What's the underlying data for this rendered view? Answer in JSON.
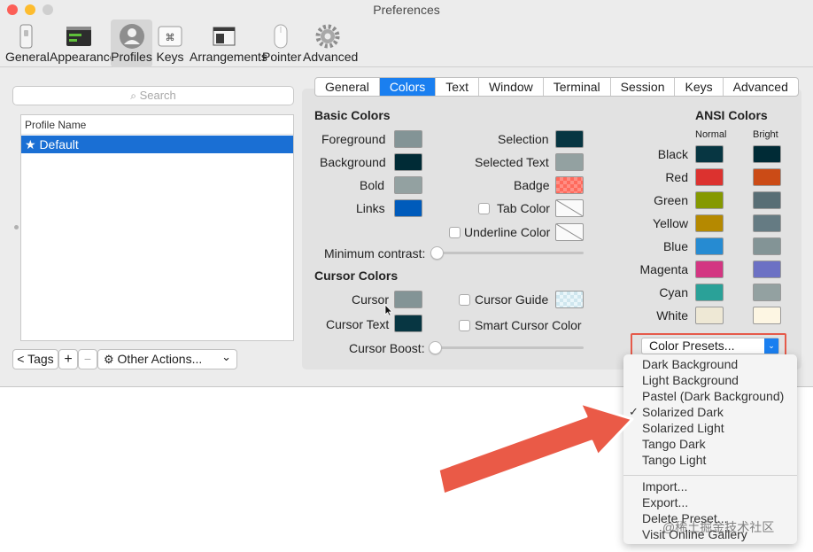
{
  "window": {
    "title": "Preferences"
  },
  "toolbar": {
    "items": [
      {
        "label": "General"
      },
      {
        "label": "Appearance"
      },
      {
        "label": "Profiles"
      },
      {
        "label": "Keys"
      },
      {
        "label": "Arrangements"
      },
      {
        "label": "Pointer"
      },
      {
        "label": "Advanced"
      }
    ],
    "keys_glyph": "⌘"
  },
  "sidebar": {
    "search_placeholder": "Search",
    "list_header": "Profile Name",
    "profiles": [
      {
        "label": "★ Default"
      }
    ],
    "tags_button": "< Tags",
    "add_button": "+",
    "remove_button": "−",
    "other_actions": "Other Actions...",
    "chevron": "⌄"
  },
  "tabs": [
    {
      "label": "General"
    },
    {
      "label": "Colors"
    },
    {
      "label": "Text"
    },
    {
      "label": "Window"
    },
    {
      "label": "Terminal"
    },
    {
      "label": "Session"
    },
    {
      "label": "Keys"
    },
    {
      "label": "Advanced"
    }
  ],
  "basic_colors": {
    "heading": "Basic Colors",
    "foreground": "Foreground",
    "background": "Background",
    "bold": "Bold",
    "links": "Links",
    "selection": "Selection",
    "selected_text": "Selected Text",
    "badge": "Badge",
    "tab_color": "Tab Color",
    "underline_color": "Underline Color",
    "minimum_contrast": "Minimum contrast:",
    "swatches": {
      "foreground": "#839496",
      "background": "#002b36",
      "bold": "#93a1a1",
      "links": "#005bbb",
      "selection": "#073642",
      "selected_text": "#93a1a1",
      "badge": "#ff6a5c"
    }
  },
  "cursor_colors": {
    "heading": "Cursor Colors",
    "cursor": "Cursor",
    "cursor_text": "Cursor Text",
    "cursor_guide": "Cursor Guide",
    "smart_cursor_color": "Smart Cursor Color",
    "cursor_boost": "Cursor Boost:",
    "swatches": {
      "cursor": "#839496",
      "cursor_text": "#073642"
    }
  },
  "ansi_colors": {
    "heading": "ANSI Colors",
    "normal": "Normal",
    "bright": "Bright",
    "rows": [
      {
        "label": "Black",
        "normal": "#073642",
        "bright": "#002b36"
      },
      {
        "label": "Red",
        "normal": "#dc322f",
        "bright": "#cb4b16"
      },
      {
        "label": "Green",
        "normal": "#859900",
        "bright": "#586e75"
      },
      {
        "label": "Yellow",
        "normal": "#b58900",
        "bright": "#657b83"
      },
      {
        "label": "Blue",
        "normal": "#268bd2",
        "bright": "#839496"
      },
      {
        "label": "Magenta",
        "normal": "#d33682",
        "bright": "#6c71c4"
      },
      {
        "label": "Cyan",
        "normal": "#2aa198",
        "bright": "#93a1a1"
      },
      {
        "label": "White",
        "normal": "#eee8d5",
        "bright": "#fdf6e3"
      }
    ]
  },
  "presets": {
    "label": "Color Presets...",
    "arrow": "⌄",
    "menu": [
      {
        "label": "Dark Background",
        "checked": false
      },
      {
        "label": "Light Background",
        "checked": false
      },
      {
        "label": "Pastel (Dark Background)",
        "checked": false
      },
      {
        "label": "Solarized Dark",
        "checked": true
      },
      {
        "label": "Solarized Light",
        "checked": false
      },
      {
        "label": "Tango Dark",
        "checked": false
      },
      {
        "label": "Tango Light",
        "checked": false
      }
    ],
    "actions": [
      {
        "label": "Import..."
      },
      {
        "label": "Export..."
      },
      {
        "label": "Delete Preset..."
      },
      {
        "label": "Visit Online Gallery"
      }
    ],
    "checkmark": "✓"
  },
  "annotation": {
    "highlight_color": "#e55a4a",
    "arrow_color": "#ea5a47"
  },
  "watermark": "@稀土掘金技术社区"
}
